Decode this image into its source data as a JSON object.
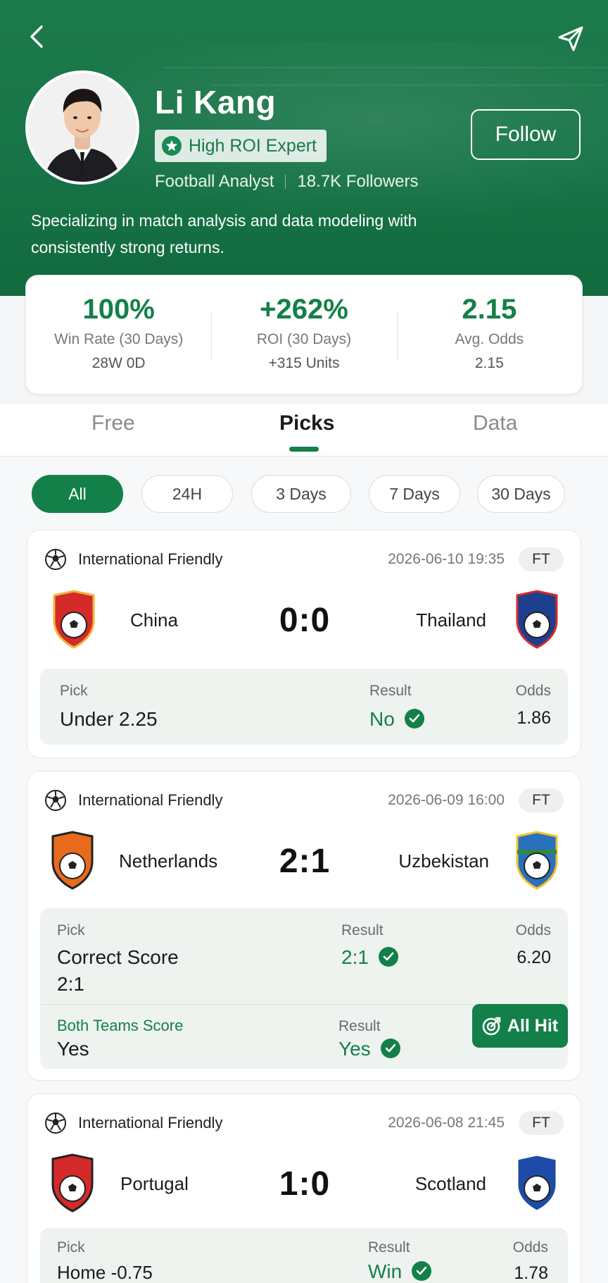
{
  "header": {
    "back_icon": "chevron-left-icon",
    "share_icon": "send-icon",
    "name": "Li Kang",
    "badge": "High ROI Expert",
    "role": "Football Analyst",
    "followers": "18.7K Followers",
    "follow_label": "Follow",
    "bio": "Specializing in match analysis and data modeling with consistently strong returns."
  },
  "stats": [
    {
      "value": "100%",
      "label": "Win Rate (30 Days)",
      "sub": "28W 0D"
    },
    {
      "value": "+262%",
      "label": "ROI (30 Days)",
      "sub": "+315 Units"
    },
    {
      "value": "2.15",
      "label": "Avg. Odds",
      "sub": "2.15"
    }
  ],
  "tabs": [
    {
      "label": "Free",
      "active": false
    },
    {
      "label": "Picks",
      "active": true
    },
    {
      "label": "Data",
      "active": false
    }
  ],
  "filters": [
    "All",
    "24H",
    "3 Days",
    "7 Days",
    "30 Days"
  ],
  "matches": [
    {
      "league": "International Friendly",
      "date": "2026-06-10 19:35",
      "status": "FT",
      "home": "China",
      "away": "Thailand",
      "score": "0:0",
      "home_color": "#d42a2a",
      "away_color": "#1e3f8f",
      "pick_label": "Pick",
      "pick": "Under 2.25",
      "result_label": "Result",
      "result": "No",
      "odds_label": "Odds",
      "odds": "1.86"
    },
    {
      "league": "International Friendly",
      "date": "2026-06-09 16:00",
      "status": "FT",
      "home": "Netherlands",
      "away": "Uzbekistan",
      "score": "2:1",
      "home_color": "#e86a1c",
      "away_color": "#2b6fbf",
      "pick_label": "Pick",
      "pick": "Correct Score",
      "pick_line2": "2:1",
      "result_label": "Result",
      "result": "2:1",
      "odds_label": "Odds",
      "odds": "6.20",
      "pick2_label": "Both Teams Score",
      "pick2": "Yes",
      "result2_label": "Result",
      "result2": "Yes",
      "allhit_label": "All Hit"
    },
    {
      "league": "International Friendly",
      "date": "2026-06-08 21:45",
      "status": "FT",
      "home": "Portugal",
      "away": "Scotland",
      "score": "1:0",
      "home_color": "#d42a2a",
      "away_color": "#1e4aa8",
      "pick_label": "Pick",
      "pick": "Home -0.75",
      "result_label": "Result",
      "result": "Win",
      "odds_label": "Odds",
      "odds": "1.78"
    }
  ],
  "colors": {
    "brand": "#138049",
    "header_bg": "#177447"
  }
}
